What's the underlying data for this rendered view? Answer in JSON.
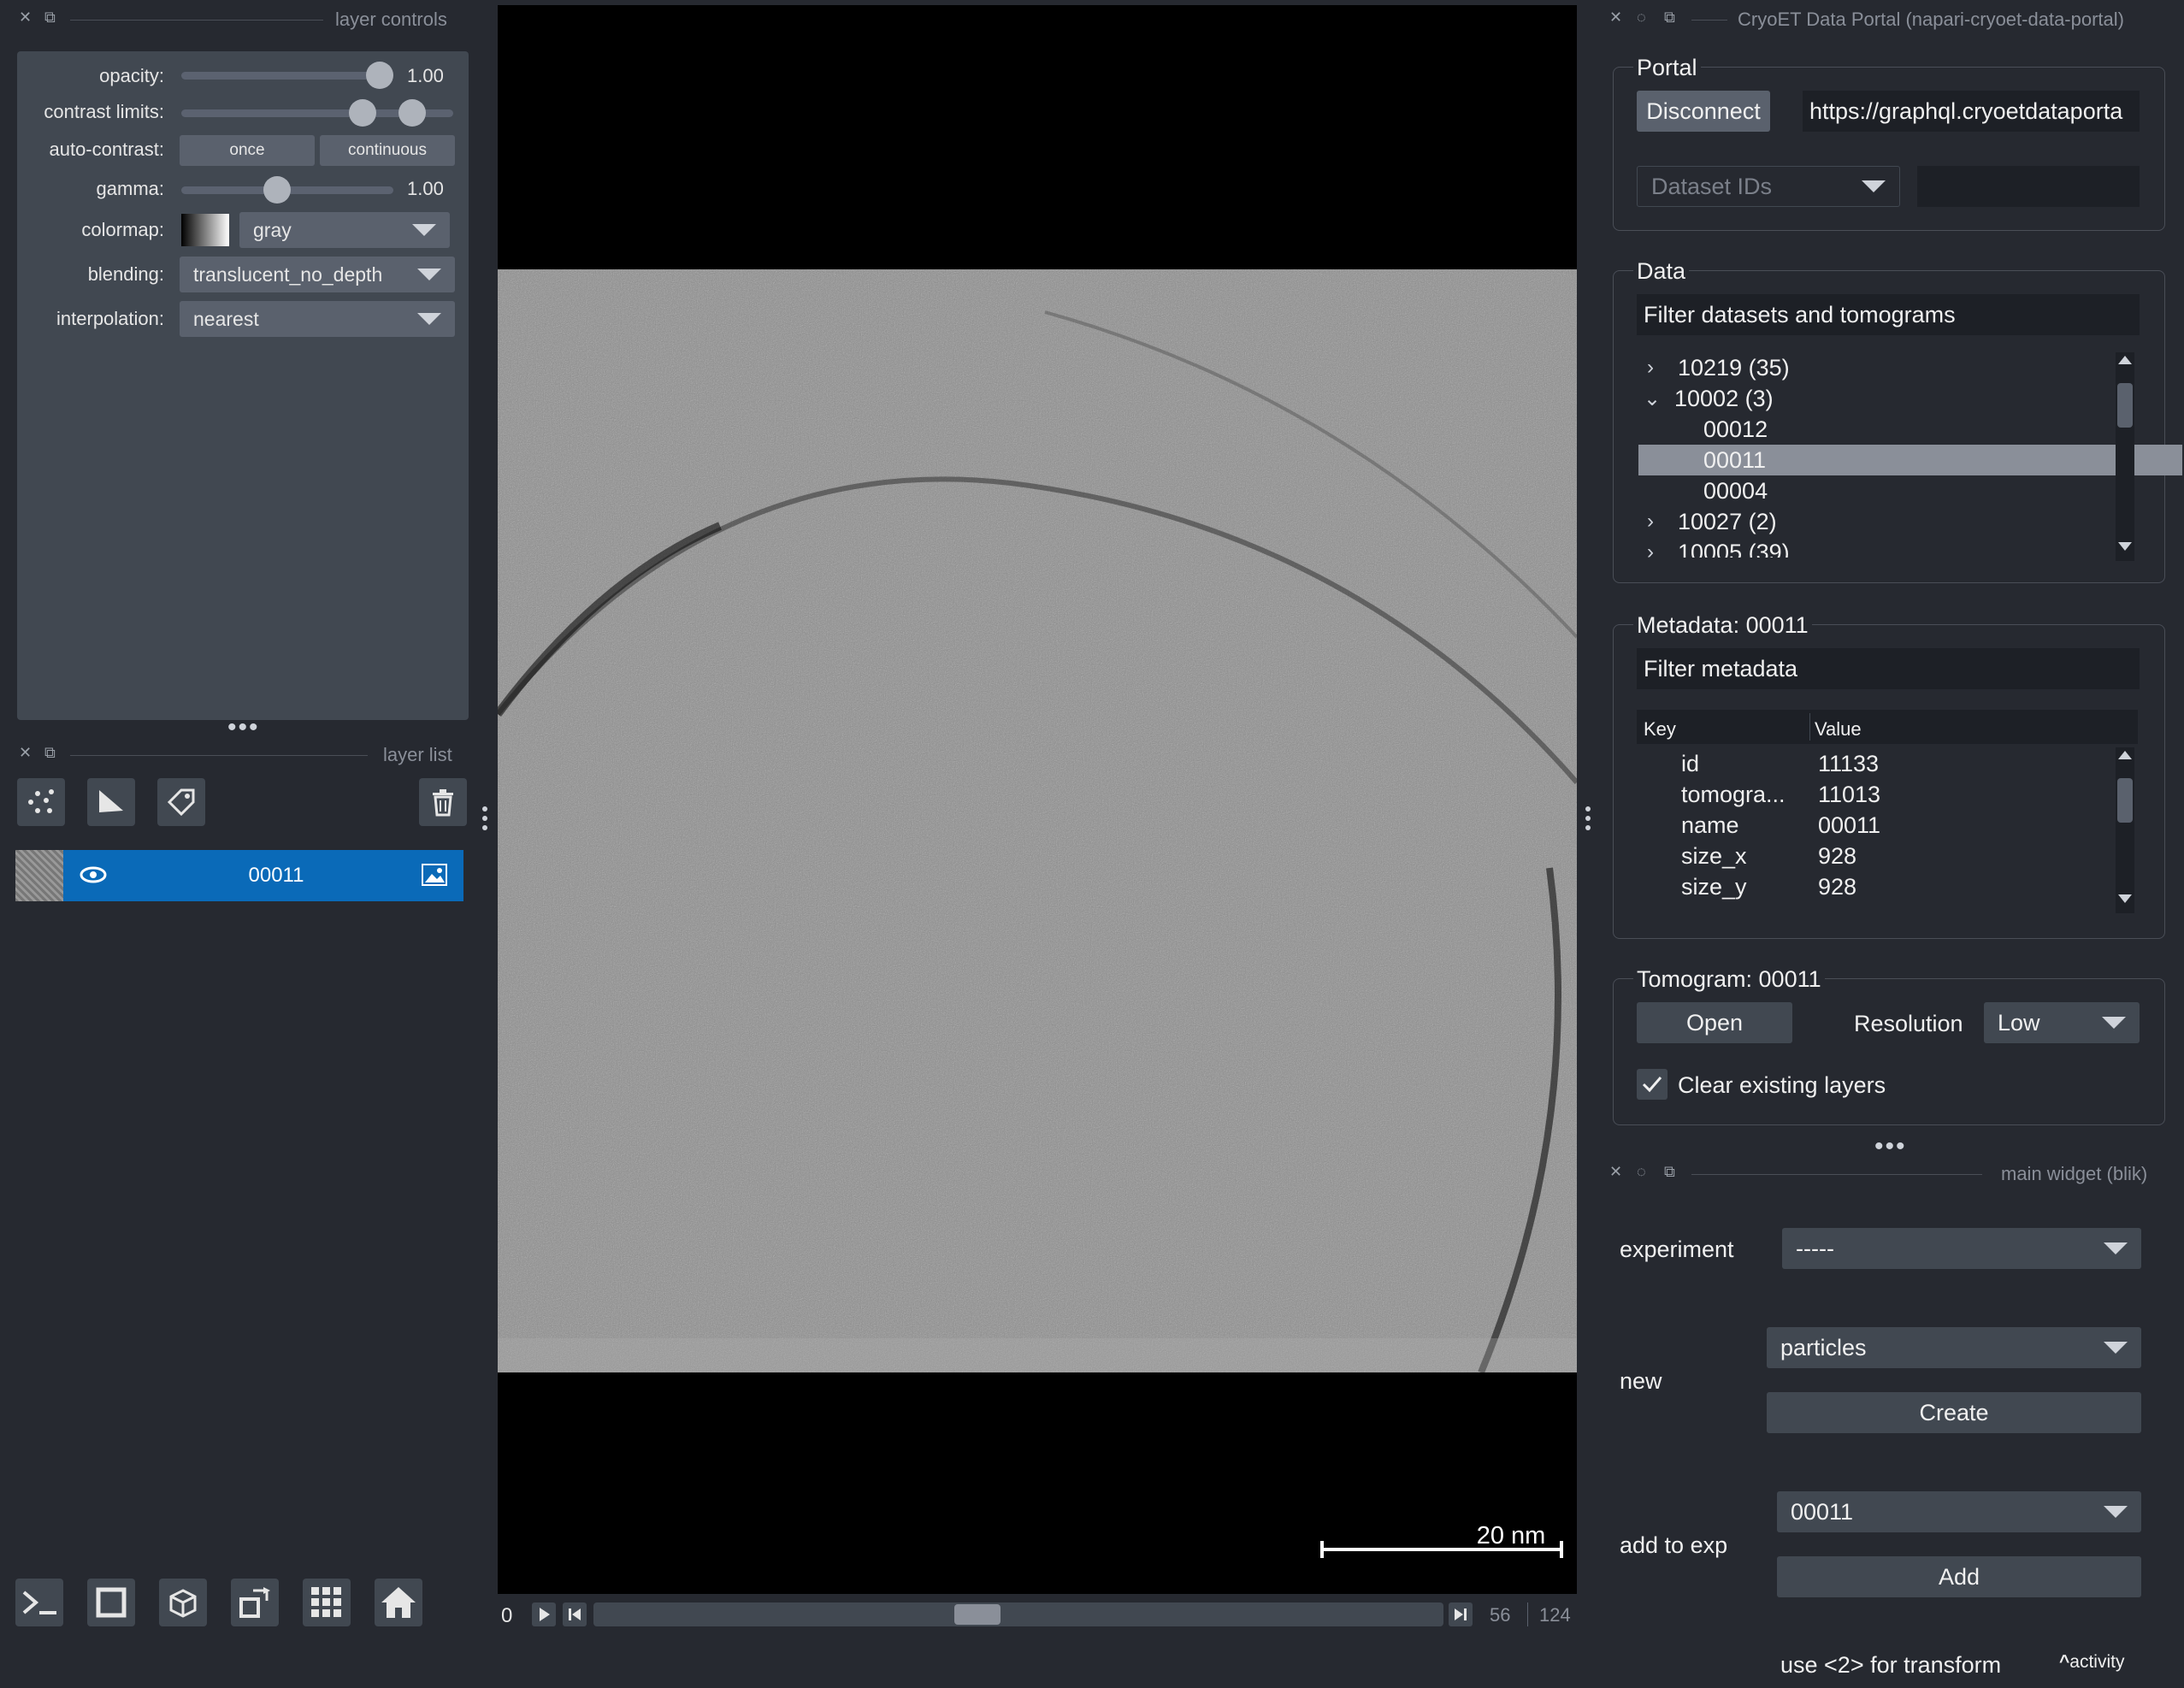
{
  "layer_controls": {
    "title": "layer controls",
    "opacity_label": "opacity:",
    "opacity_value": "1.00",
    "opacity_level": 1.0,
    "contrast_label": "contrast limits:",
    "autocontrast_label": "auto-contrast:",
    "once_label": "once",
    "continuous_label": "continuous",
    "gamma_label": "gamma:",
    "gamma_value": "1.00",
    "colormap_label": "colormap:",
    "colormap_value": "gray",
    "blending_label": "blending:",
    "blending_value": "translucent_no_depth",
    "interpolation_label": "interpolation:",
    "interpolation_value": "nearest"
  },
  "layer_list": {
    "title": "layer list",
    "layers": [
      {
        "name": "00011"
      }
    ]
  },
  "viewer": {
    "scale_bar": "20 nm",
    "frame_start": "0",
    "frame_current": "56",
    "frame_total": "124"
  },
  "portal": {
    "title": "CryoET Data Portal (napari-cryoet-data-portal)",
    "group_title": "Portal",
    "disconnect_label": "Disconnect",
    "url": "https://graphql.cryoetdataporta",
    "dataset_ids_placeholder": "Dataset IDs",
    "data_group_title": "Data",
    "filter_placeholder": "Filter datasets and tomograms",
    "tree": [
      {
        "label": "10219 (35)",
        "indent": 0,
        "arrow": "›"
      },
      {
        "label": "10002 (3)",
        "indent": 0,
        "arrow": "⌄"
      },
      {
        "label": "00012",
        "indent": 1,
        "arrow": ""
      },
      {
        "label": "00011",
        "indent": 1,
        "arrow": "",
        "selected": true
      },
      {
        "label": "00004",
        "indent": 1,
        "arrow": ""
      },
      {
        "label": "10027 (2)",
        "indent": 0,
        "arrow": "›"
      },
      {
        "label": "10005 (39)",
        "indent": 0,
        "arrow": "›"
      }
    ],
    "metadata_title": "Metadata: 00011",
    "metadata_filter_placeholder": "Filter metadata",
    "key_header": "Key",
    "value_header": "Value",
    "metadata": [
      {
        "key": "id",
        "value": "11133"
      },
      {
        "key": "tomogra...",
        "value": "11013"
      },
      {
        "key": "name",
        "value": "00011"
      },
      {
        "key": "size_x",
        "value": "928"
      },
      {
        "key": "size_y",
        "value": "928"
      }
    ],
    "tomogram_title": "Tomogram: 00011",
    "open_label": "Open",
    "resolution_label": "Resolution",
    "resolution_value": "Low",
    "clear_layers_label": "Clear existing layers",
    "clear_layers_checked": true
  },
  "main_widget": {
    "title": "main widget (blik)",
    "experiment_label": "experiment",
    "experiment_value": "-----",
    "new_label": "new",
    "new_value": "particles",
    "create_label": "Create",
    "add_to_exp_label": "add to exp",
    "add_value": "00011",
    "add_label": "Add",
    "status": "use <2> for transform",
    "activity_label": "activity"
  },
  "colors": {
    "background": "#262930",
    "panel": "#414851",
    "selected_layer": "#0a6ab8",
    "selected_row": "#8a8f99"
  }
}
